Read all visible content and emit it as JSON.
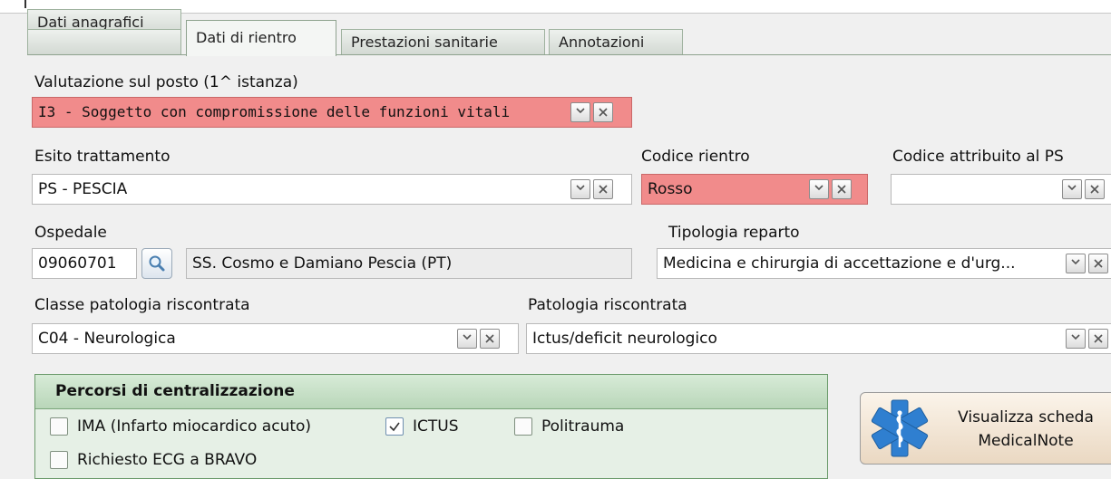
{
  "tabs": [
    {
      "label": "Dati anagrafici"
    },
    {
      "label": "Dati di rientro"
    },
    {
      "label": "Prestazioni sanitarie"
    },
    {
      "label": "Annotazioni"
    }
  ],
  "valutazione": {
    "label": "Valutazione sul posto (1^ istanza)",
    "value": "I3 - Soggetto con compromissione delle funzioni vitali"
  },
  "esito": {
    "label": "Esito trattamento",
    "value": "PS - PESCIA"
  },
  "codice_rientro": {
    "label": "Codice rientro",
    "value": "Rosso"
  },
  "codice_ps": {
    "label": "Codice attribuito al PS",
    "value": ""
  },
  "ospedale": {
    "label": "Ospedale",
    "code": "09060701",
    "name": "SS. Cosmo e Damiano Pescia (PT)"
  },
  "tipologia": {
    "label": "Tipologia reparto",
    "value": "Medicina e chirurgia di accettazione e d'urg..."
  },
  "classe_patologia": {
    "label": "Classe patologia riscontrata",
    "value": "C04 - Neurologica"
  },
  "patologia": {
    "label": "Patologia riscontrata",
    "value": "Ictus/deficit neurologico"
  },
  "percorsi": {
    "title": "Percorsi di centralizzazione",
    "items": [
      {
        "label": "IMA (Infarto miocardico acuto)",
        "checked": false
      },
      {
        "label": "ICTUS",
        "checked": true
      },
      {
        "label": "Politrauma",
        "checked": false
      },
      {
        "label": "Richiesto ECG a BRAVO",
        "checked": false
      }
    ]
  },
  "medicalnote": {
    "line1": "Visualizza scheda",
    "line2": "MedicalNote"
  },
  "colors": {
    "critical": "#f18b8b",
    "tab_border": "#8ea28e",
    "group_bg": "#e6f0e6",
    "star_of_life": "#2f7fd0"
  },
  "icons": {
    "dropdown": "chevron-down-icon",
    "clear": "close-icon",
    "lookup": "search-icon",
    "medicalnote": "star-of-life-icon"
  }
}
